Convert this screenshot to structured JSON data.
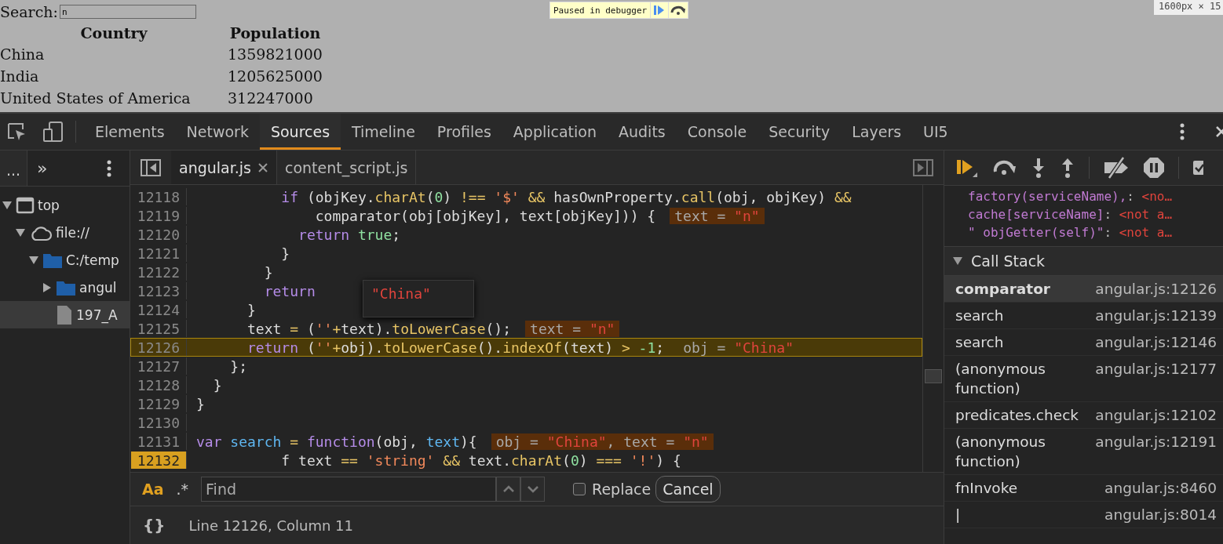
{
  "page": {
    "search_label": "Search:",
    "search_value": "n",
    "columns": [
      "Country",
      "Population"
    ],
    "rows": [
      [
        "China",
        "1359821000"
      ],
      [
        "India",
        "1205625000"
      ],
      [
        "United States of America",
        "312247000"
      ]
    ],
    "paused_label": "Paused in debugger",
    "size_badge": "1600px × 15"
  },
  "tabs": [
    {
      "label": "Elements",
      "selected": false
    },
    {
      "label": "Network",
      "selected": false
    },
    {
      "label": "Sources",
      "selected": true
    },
    {
      "label": "Timeline",
      "selected": false
    },
    {
      "label": "Profiles",
      "selected": false
    },
    {
      "label": "Application",
      "selected": false
    },
    {
      "label": "Audits",
      "selected": false
    },
    {
      "label": "Console",
      "selected": false
    },
    {
      "label": "Security",
      "selected": false
    },
    {
      "label": "Layers",
      "selected": false
    },
    {
      "label": "UI5",
      "selected": false
    }
  ],
  "navigator": {
    "tab": "...",
    "more": "»",
    "tree": [
      {
        "label": "top",
        "kind": "window",
        "expanded": true,
        "selected": false,
        "children": [
          {
            "label": "file://",
            "kind": "cloud",
            "expanded": true,
            "selected": false,
            "children": [
              {
                "label": "C:/temp",
                "kind": "folder",
                "expanded": true,
                "selected": false,
                "children": [
                  {
                    "label": "angul",
                    "kind": "folder",
                    "expanded": false,
                    "selected": false
                  },
                  {
                    "label": "197_A",
                    "kind": "file",
                    "selected": true
                  }
                ]
              }
            ]
          }
        ]
      }
    ]
  },
  "editor": {
    "files": [
      {
        "label": "angular.js",
        "selected": true,
        "closable": true
      },
      {
        "label": "content_script.js",
        "selected": false,
        "closable": false
      }
    ],
    "lines": [
      {
        "no": "12118",
        "current": false,
        "marked": false,
        "tokens": [
          {
            "t": "          if",
            "kind": "keyword"
          },
          {
            "t": " (objKey.",
            "kind": "plain"
          },
          {
            "t": "charAt",
            "kind": "method"
          },
          {
            "t": "(",
            "kind": "plain"
          },
          {
            "t": "0",
            "kind": "literal"
          },
          {
            "t": ") ",
            "kind": "plain"
          },
          {
            "t": "!== ",
            "kind": "method"
          },
          {
            "t": "'$' ",
            "kind": "string"
          },
          {
            "t": "&&",
            "kind": "method"
          },
          {
            "t": " hasOwnProperty.",
            "kind": "plain"
          },
          {
            "t": "call",
            "kind": "method"
          },
          {
            "t": "(obj, objKey) ",
            "kind": "plain"
          },
          {
            "t": "&&",
            "kind": "method"
          }
        ]
      },
      {
        "no": "12119",
        "current": false,
        "marked": false,
        "tokens": [
          {
            "t": "              comparator(obj[objKey], text[objKey])) {",
            "kind": "plain"
          }
        ],
        "inline": [
          {
            "t": "text = ",
            "kind": "name"
          },
          {
            "t": "\"n\"",
            "kind": "value"
          }
        ]
      },
      {
        "no": "12120",
        "current": false,
        "marked": false,
        "tokens": [
          {
            "t": "            return ",
            "kind": "keyword"
          },
          {
            "t": "true",
            "kind": "literal"
          },
          {
            "t": ";",
            "kind": "plain"
          }
        ]
      },
      {
        "no": "12121",
        "current": false,
        "marked": false,
        "tokens": [
          {
            "t": "          }",
            "kind": "plain"
          }
        ]
      },
      {
        "no": "12122",
        "current": false,
        "marked": false,
        "tokens": [
          {
            "t": "        }",
            "kind": "plain"
          }
        ]
      },
      {
        "no": "12123",
        "current": false,
        "marked": false,
        "tokens": [
          {
            "t": "        return",
            "kind": "keyword"
          }
        ]
      },
      {
        "no": "12124",
        "current": false,
        "marked": false,
        "tokens": [
          {
            "t": "      }",
            "kind": "plain"
          }
        ]
      },
      {
        "no": "12125",
        "current": false,
        "marked": false,
        "tokens": [
          {
            "t": "      text ",
            "kind": "plain"
          },
          {
            "t": "=",
            "kind": "method"
          },
          {
            "t": " (",
            "kind": "plain"
          },
          {
            "t": "''",
            "kind": "string"
          },
          {
            "t": "+",
            "kind": "method"
          },
          {
            "t": "text).",
            "kind": "plain"
          },
          {
            "t": "toLowerCase",
            "kind": "method"
          },
          {
            "t": "();",
            "kind": "plain"
          }
        ],
        "inline": [
          {
            "t": "text = ",
            "kind": "name"
          },
          {
            "t": "\"n\"",
            "kind": "value"
          }
        ]
      },
      {
        "no": "12126",
        "current": true,
        "marked": false,
        "tokens": [
          {
            "t": "      return",
            "kind": "keyword"
          },
          {
            "t": " (",
            "kind": "plain"
          },
          {
            "t": "''",
            "kind": "string"
          },
          {
            "t": "+",
            "kind": "method"
          },
          {
            "t": "obj).",
            "kind": "plain"
          },
          {
            "t": "toLowerCase",
            "kind": "method"
          },
          {
            "t": "().",
            "kind": "plain"
          },
          {
            "t": "indexOf",
            "kind": "method"
          },
          {
            "t": "(text) ",
            "kind": "plain"
          },
          {
            "t": "> ",
            "kind": "method"
          },
          {
            "t": "-1",
            "kind": "literal"
          },
          {
            "t": ";",
            "kind": "plain"
          }
        ],
        "inline": [
          {
            "t": "obj = ",
            "kind": "name"
          },
          {
            "t": "\"China\"",
            "kind": "value"
          }
        ]
      },
      {
        "no": "12127",
        "current": false,
        "marked": false,
        "tokens": [
          {
            "t": "    };",
            "kind": "plain"
          }
        ]
      },
      {
        "no": "12128",
        "current": false,
        "marked": false,
        "tokens": [
          {
            "t": "  }",
            "kind": "plain"
          }
        ]
      },
      {
        "no": "12129",
        "current": false,
        "marked": false,
        "tokens": [
          {
            "t": "}",
            "kind": "plain"
          }
        ]
      },
      {
        "no": "12130",
        "current": false,
        "marked": false
      },
      {
        "no": "12131",
        "current": false,
        "marked": false,
        "tokens": [
          {
            "t": "var ",
            "kind": "keyword"
          },
          {
            "t": "search ",
            "kind": "def"
          },
          {
            "t": "= ",
            "kind": "method"
          },
          {
            "t": "function",
            "kind": "keyword"
          },
          {
            "t": "(obj, ",
            "kind": "plain"
          },
          {
            "t": "text",
            "kind": "def"
          },
          {
            "t": "){",
            "kind": "plain"
          }
        ],
        "inline": [
          {
            "t": "obj = ",
            "kind": "name"
          },
          {
            "t": "\"China\"",
            "kind": "value"
          },
          {
            "t": ", text = ",
            "kind": "name"
          },
          {
            "t": "\"n\"",
            "kind": "value"
          }
        ]
      },
      {
        "no": "12132",
        "current": false,
        "marked": true,
        "tokens": [
          {
            "t": "          f text ",
            "kind": "plain"
          },
          {
            "t": "== ",
            "kind": "method"
          },
          {
            "t": "'string' ",
            "kind": "string"
          },
          {
            "t": "&&",
            "kind": "method"
          },
          {
            "t": " text.",
            "kind": "plain"
          },
          {
            "t": "charAt",
            "kind": "method"
          },
          {
            "t": "(",
            "kind": "plain"
          },
          {
            "t": "0",
            "kind": "literal"
          },
          {
            "t": ") ",
            "kind": "plain"
          },
          {
            "t": "=== ",
            "kind": "method"
          },
          {
            "t": "'!'",
            "kind": "string"
          },
          {
            "t": ") {",
            "kind": "plain"
          }
        ]
      }
    ],
    "tooltip": "\"China\"",
    "find": {
      "case_label": "Aa",
      "regex_label": ".*",
      "placeholder": "Find",
      "replace_label": "Replace",
      "replace_checked": false,
      "cancel": "Cancel"
    },
    "status": {
      "format_label": "{}",
      "position": "Line 12126, Column 11"
    }
  },
  "sidebar": {
    "scope": [
      {
        "key": "factory(serviceName),",
        "punct": ":",
        "value": "<no…"
      },
      {
        "key": "cache[serviceName]",
        "punct": ":",
        "value": "<not a…"
      },
      {
        "key": "\" objGetter(self)\"",
        "punct": ":",
        "value": "<not a…"
      }
    ],
    "call_stack": {
      "title": "Call Stack",
      "expanded": true,
      "frames": [
        {
          "name": "comparator",
          "location": "angular.js:12126",
          "selected": true
        },
        {
          "name": "search",
          "location": "angular.js:12139",
          "selected": false
        },
        {
          "name": "search",
          "location": "angular.js:12146",
          "selected": false
        },
        {
          "name": "(anonymous function)",
          "location": "angular.js:12177",
          "selected": false
        },
        {
          "name": "predicates.check",
          "location": "angular.js:12102",
          "selected": false
        },
        {
          "name": "(anonymous function)",
          "location": "angular.js:12191",
          "selected": false
        },
        {
          "name": "fnInvoke",
          "location": "angular.js:8460",
          "selected": false
        },
        {
          "name": "|",
          "location": "angular.js:8014",
          "selected": false
        }
      ]
    }
  }
}
